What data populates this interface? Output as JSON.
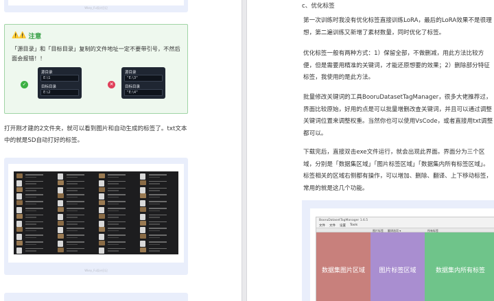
{
  "left": {
    "watermark": "Wkey_Fu设计日记",
    "note": {
      "icons": "⚠️⚠️",
      "title": "注意",
      "text": "「源目录」和「目标目录」复制的文件地址一定不要带引号，不然后面会报错！！",
      "good": {
        "label1": "源目录",
        "value1": "E:\\1",
        "label2": "目标目录",
        "value2": "E:\\2"
      },
      "bad": {
        "label1": "源目录",
        "value1": "\"E:\\3\"",
        "label2": "目标目录",
        "value2": "\"E:\\4\""
      }
    },
    "para1": "打开刚才建的2文件夹，就可以看到图片和自动生成的标签了。txt文本中的就是SD自动打好的标签。"
  },
  "right": {
    "heading": "c、优化标签",
    "para1": "第一次训练时我没有优化标签直接训练LoRA，最后的LoRA效果不是很理想，第二遍训练又新增了素材数量，同时优化了标签。",
    "para2": "优化标签一般有两种方式：1）保留全部，不做删减，用此方法比较方便，但是需要用精准的关键词，才能还原想要的效果；2）删除部分特征标签，我使用的是此方法。",
    "para3": "批量修改关键词的工具BooruDatasetTagManager，很多大佬推荐过，界面比较原始，好用的点是可以批量增删改查关键词，并且可以通过调整关键词位置来调整权重。当然你也可以使用VsCode，或者直接用txt调整都可以。",
    "para4": "下载完后，直接双击exe文件运行，就会出现此界面。界面分为三个区域，分别是「数据集区域」「图片标签区域」「数据集内所有标签区域」。标签相关的区域右侧都有操作，可以增加、删除、翻译、上下移动标签，常用的就是这几个功能。",
    "tool": {
      "title": "BooruDatasetTagManager 1.6.5",
      "menu": [
        "文件",
        "文件",
        "设置",
        "Tools"
      ],
      "toolbar": [
        "图片标签",
        "翻译选项 ▾",
        "所有标签"
      ],
      "region_a": "数据集图片区域",
      "region_b": "图片标签区域",
      "region_c": "数据集内所有标签"
    }
  }
}
